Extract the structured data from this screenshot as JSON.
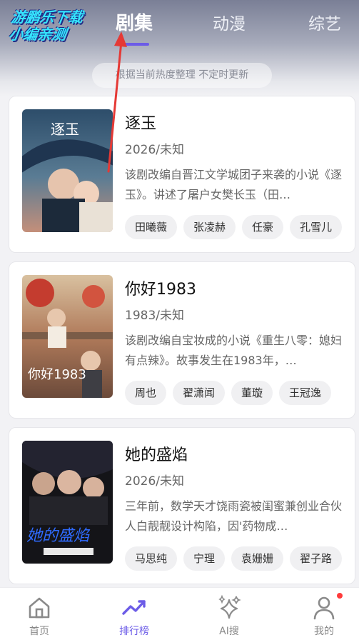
{
  "watermark": {
    "line1": "游鹏乐下载",
    "line2": "小编亲测"
  },
  "tabs": [
    {
      "label": "剧集",
      "active": true
    },
    {
      "label": "动漫",
      "active": false
    },
    {
      "label": "综艺",
      "active": false
    }
  ],
  "notice": "根据当前热度整理 不定时更新",
  "items": [
    {
      "title": "逐玉",
      "year": "2026/未知",
      "desc": "该剧改编自晋江文学城团子来袭的小说《逐玉》。讲述了屠户女樊长玉（田…",
      "cast": [
        "田曦薇",
        "张凌赫",
        "任豪",
        "孔雪儿"
      ],
      "poster_text": "逐玉"
    },
    {
      "title": "你好1983",
      "year": "1983/未知",
      "desc": "该剧改编自宝妆成的小说《重生八零：媳妇有点辣》。故事发生在1983年，…",
      "cast": [
        "周也",
        "翟潇闻",
        "董璇",
        "王冠逸"
      ],
      "poster_text": "你好1983"
    },
    {
      "title": "她的盛焰",
      "year": "2026/未知",
      "desc": "三年前，数学天才饶雨瓷被闺蜜兼创业合伙人白靓靓设计构陷，因'药物成…",
      "cast": [
        "马思纯",
        "宁理",
        "袁姗姗",
        "翟子路"
      ],
      "poster_text": "她的盛焰"
    }
  ],
  "nav": [
    {
      "label": "首页",
      "icon": "home-icon",
      "active": false
    },
    {
      "label": "排行榜",
      "icon": "trend-icon",
      "active": true
    },
    {
      "label": "AI搜",
      "icon": "sparkle-icon",
      "active": false
    },
    {
      "label": "我的",
      "icon": "person-icon",
      "active": false
    }
  ],
  "colors": {
    "accent": "#6c5ce7",
    "notification": "#ff3b3b",
    "arrow": "#e53935"
  }
}
